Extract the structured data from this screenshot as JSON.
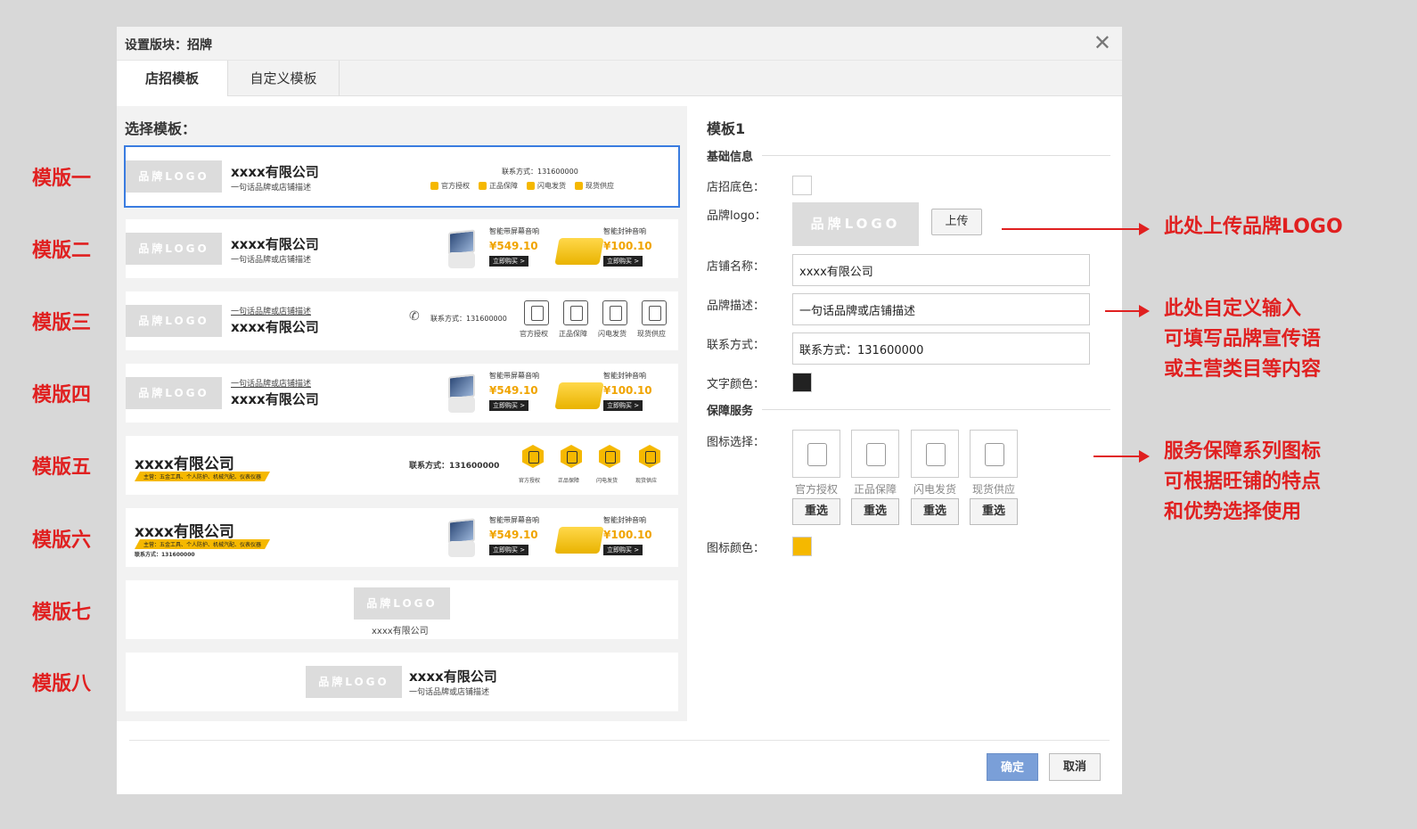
{
  "dialog": {
    "title": "设置版块：招牌",
    "close": "✕",
    "tabs": [
      "店招模板",
      "自定义模板"
    ],
    "ok_label": "确定",
    "cancel_label": "取消"
  },
  "side_labels": [
    "模版一",
    "模版二",
    "模版三",
    "模版四",
    "模版五",
    "模版六",
    "模版七",
    "模版八"
  ],
  "annotations": {
    "logo": "此处上传品牌LOGO",
    "desc_line1": "此处自定义输入",
    "desc_line2": "可填写品牌宣传语",
    "desc_line3": "或主营类目等内容",
    "svc_line1": "服务保障系列图标",
    "svc_line2": "可根据旺铺的特点",
    "svc_line3": "和优势选择使用"
  },
  "left": {
    "title": "选择模板：",
    "logo_text": "品牌LOGO",
    "company": "xxxx有限公司",
    "company_plain": "xxxx有限公司",
    "desc": "一句话品牌或店铺描述",
    "contact": "联系方式：131600000",
    "contact_bold": "联系方式：131600000",
    "services": [
      "官方授权",
      "正品保障",
      "闪电发货",
      "现货供应"
    ],
    "product1": {
      "name": "智能带屏幕音响",
      "price": "¥549.10",
      "buy": "立即购买 >"
    },
    "product2": {
      "name": "智能封钟音响",
      "price": "¥100.10",
      "buy": "立即购买 >"
    },
    "tag": "主营：五金工具、个人防护、机械汽配、仪表仪器",
    "tag_full": "主营：五金工具、个人防护、机械汽配、仪表仪器"
  },
  "right": {
    "title": "模板1",
    "sec_basic": "基础信息",
    "bg_color_label": "店招底色：",
    "logo_label": "品牌logo：",
    "logo_preview": "品牌LOGO",
    "upload": "上传",
    "name_label": "店铺名称：",
    "name_value": "xxxx有限公司",
    "desc_label": "品牌描述：",
    "desc_value": "一句话品牌或店铺描述",
    "contact_label": "联系方式：",
    "contact_value": "联系方式：131600000",
    "text_color_label": "文字颜色：",
    "sec_service": "保障服务",
    "icon_select_label": "图标选择：",
    "icons": [
      "官方授权",
      "正品保障",
      "闪电发货",
      "现货供应"
    ],
    "reselect": "重选",
    "icon_color_label": "图标颜色："
  },
  "colors": {
    "accent_red": "#e02020",
    "selected_border": "#3a7ce0",
    "icon_yellow": "#f5b800",
    "text_black": "#222222",
    "bg_white": "#ffffff"
  }
}
